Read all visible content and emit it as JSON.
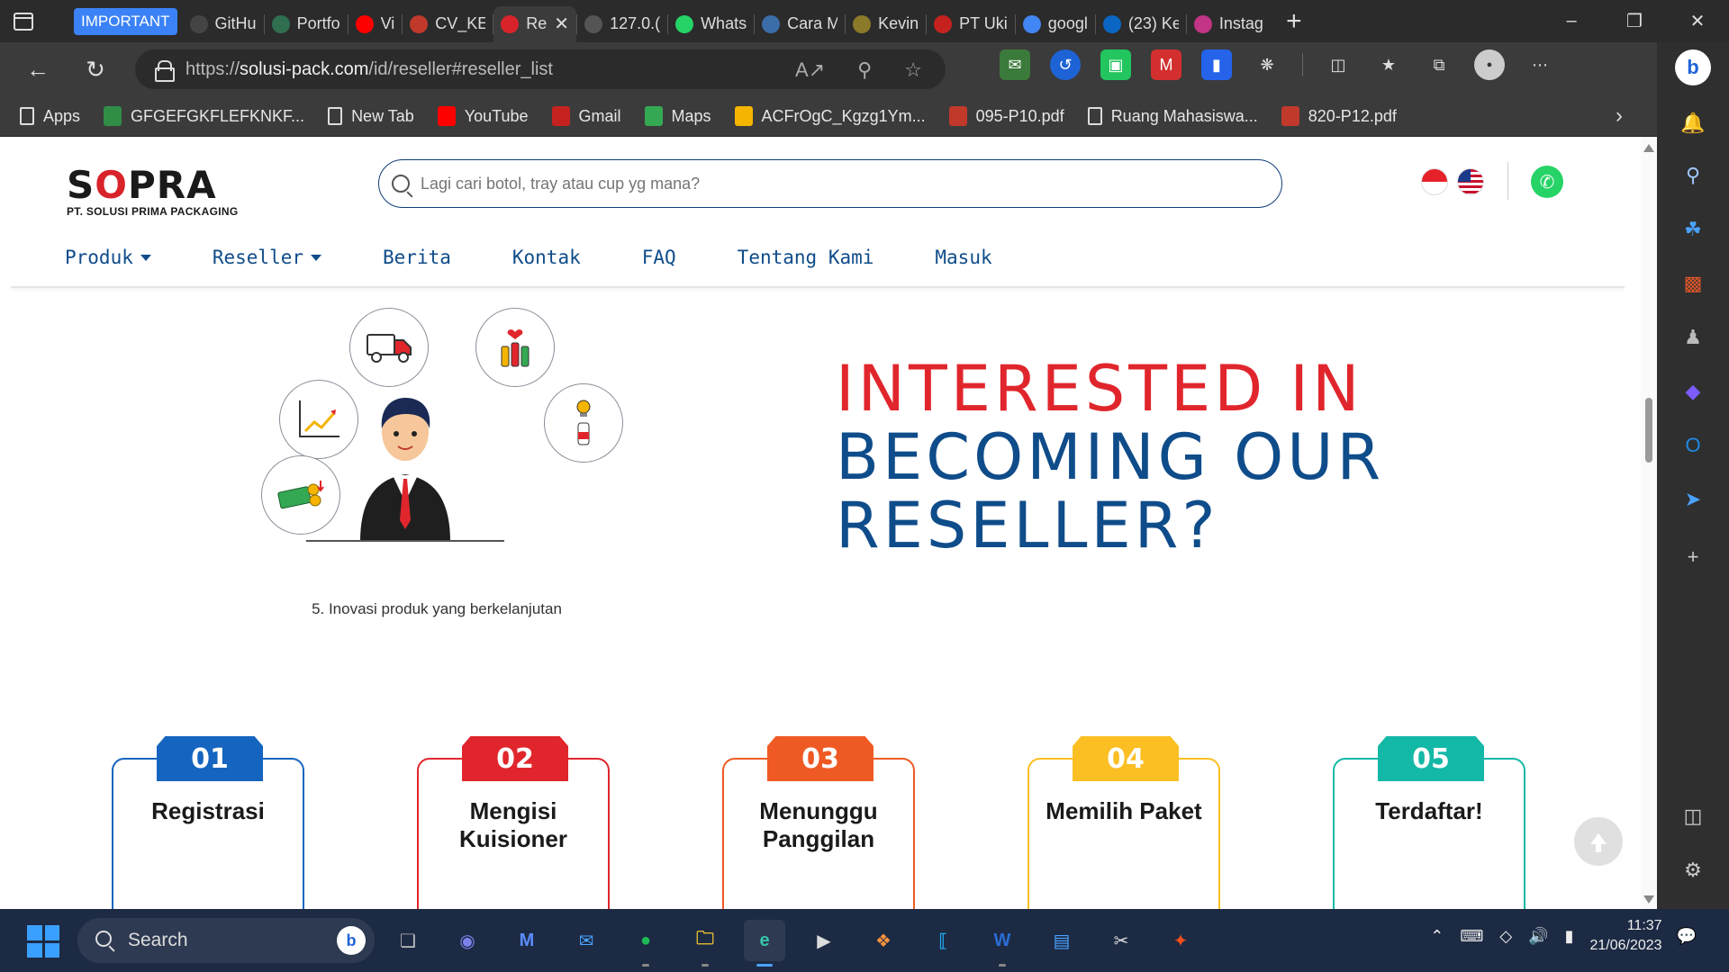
{
  "browser": {
    "tab_group_label": "IMPORTANT",
    "tabs": [
      {
        "title": "GitHu",
        "icon": "github-icon",
        "color": "#444444"
      },
      {
        "title": "Portfo",
        "icon": "portfolio-icon",
        "color": "#2f6f4f"
      },
      {
        "title": "Vi",
        "icon": "youtube-icon",
        "color": "#ff0000"
      },
      {
        "title": "CV_KE",
        "icon": "pdf-icon",
        "color": "#c0392b"
      },
      {
        "title": "Re",
        "icon": "sopra-icon",
        "color": "#d8232a",
        "active": true
      },
      {
        "title": "127.0.(",
        "icon": "page-icon",
        "color": "#555555"
      },
      {
        "title": "Whats",
        "icon": "whatsapp-icon",
        "color": "#25d366"
      },
      {
        "title": "Cara M",
        "icon": "cara-icon",
        "color": "#3b6ea8"
      },
      {
        "title": "Kevin",
        "icon": "kevin-icon",
        "color": "#8a7a2a"
      },
      {
        "title": "PT Uki",
        "icon": "gmail-icon",
        "color": "#c5221f"
      },
      {
        "title": "googl",
        "icon": "google-icon",
        "color": "#4285f4"
      },
      {
        "title": "(23) Ke",
        "icon": "linkedin-icon",
        "color": "#0a66c2"
      },
      {
        "title": "Instag",
        "icon": "instagram-icon",
        "color": "#c13584"
      }
    ],
    "url_prefix": "https://",
    "url_host": "solusi-pack.com",
    "url_path": "/id/reseller#reseller_list",
    "bookmarks": [
      {
        "label": "Apps",
        "icon": "page-icon"
      },
      {
        "label": "GFGEFGKFLEFKNKF...",
        "icon": "gfg-icon",
        "color": "#2f8d46"
      },
      {
        "label": "New Tab",
        "icon": "page-icon"
      },
      {
        "label": "YouTube",
        "icon": "youtube-icon",
        "color": "#ff0000"
      },
      {
        "label": "Gmail",
        "icon": "gmail-icon",
        "color": "#c5221f"
      },
      {
        "label": "Maps",
        "icon": "maps-icon",
        "color": "#34a853"
      },
      {
        "label": "ACFrOgC_Kgzg1Ym...",
        "icon": "drive-icon",
        "color": "#f4b400"
      },
      {
        "label": "095-P10.pdf",
        "icon": "pdf-icon",
        "color": "#c0392b"
      },
      {
        "label": "Ruang Mahasiswa...",
        "icon": "page-icon"
      },
      {
        "label": "820-P12.pdf",
        "icon": "pdf-icon",
        "color": "#c0392b"
      }
    ]
  },
  "site": {
    "logo_text": "SOPRA",
    "logo_subtitle": "PT. SOLUSI PRIMA PACKAGING",
    "search_placeholder": "Lagi cari botol, tray atau cup yg mana?",
    "nav": [
      {
        "label": "Produk",
        "dropdown": true
      },
      {
        "label": "Reseller",
        "dropdown": true
      },
      {
        "label": "Berita",
        "dropdown": false
      },
      {
        "label": "Kontak",
        "dropdown": false
      },
      {
        "label": "FAQ",
        "dropdown": false
      },
      {
        "label": "Tentang Kami",
        "dropdown": false
      },
      {
        "label": "Masuk",
        "dropdown": false
      }
    ],
    "illustration_caption": "5. Inovasi produk yang berkelanjutan",
    "hero": {
      "line1": "INTERESTED IN",
      "line2": "BECOMING OUR",
      "line3": "RESELLER?",
      "color_red": "#e0262c",
      "color_blue": "#0f4c8a"
    },
    "steps": [
      {
        "num": "01",
        "label": "Registrasi",
        "color": "#1565c0"
      },
      {
        "num": "02",
        "label": "Mengisi Kuisioner",
        "color": "#e0262c"
      },
      {
        "num": "03",
        "label": "Menunggu Panggilan",
        "color": "#ef5a24"
      },
      {
        "num": "04",
        "label": "Memilih Paket",
        "color": "#fbbf24"
      },
      {
        "num": "05",
        "label": "Terdaftar!",
        "color": "#14b8a6"
      }
    ]
  },
  "taskbar": {
    "search_label": "Search",
    "time": "11:37",
    "date": "21/06/2023"
  }
}
